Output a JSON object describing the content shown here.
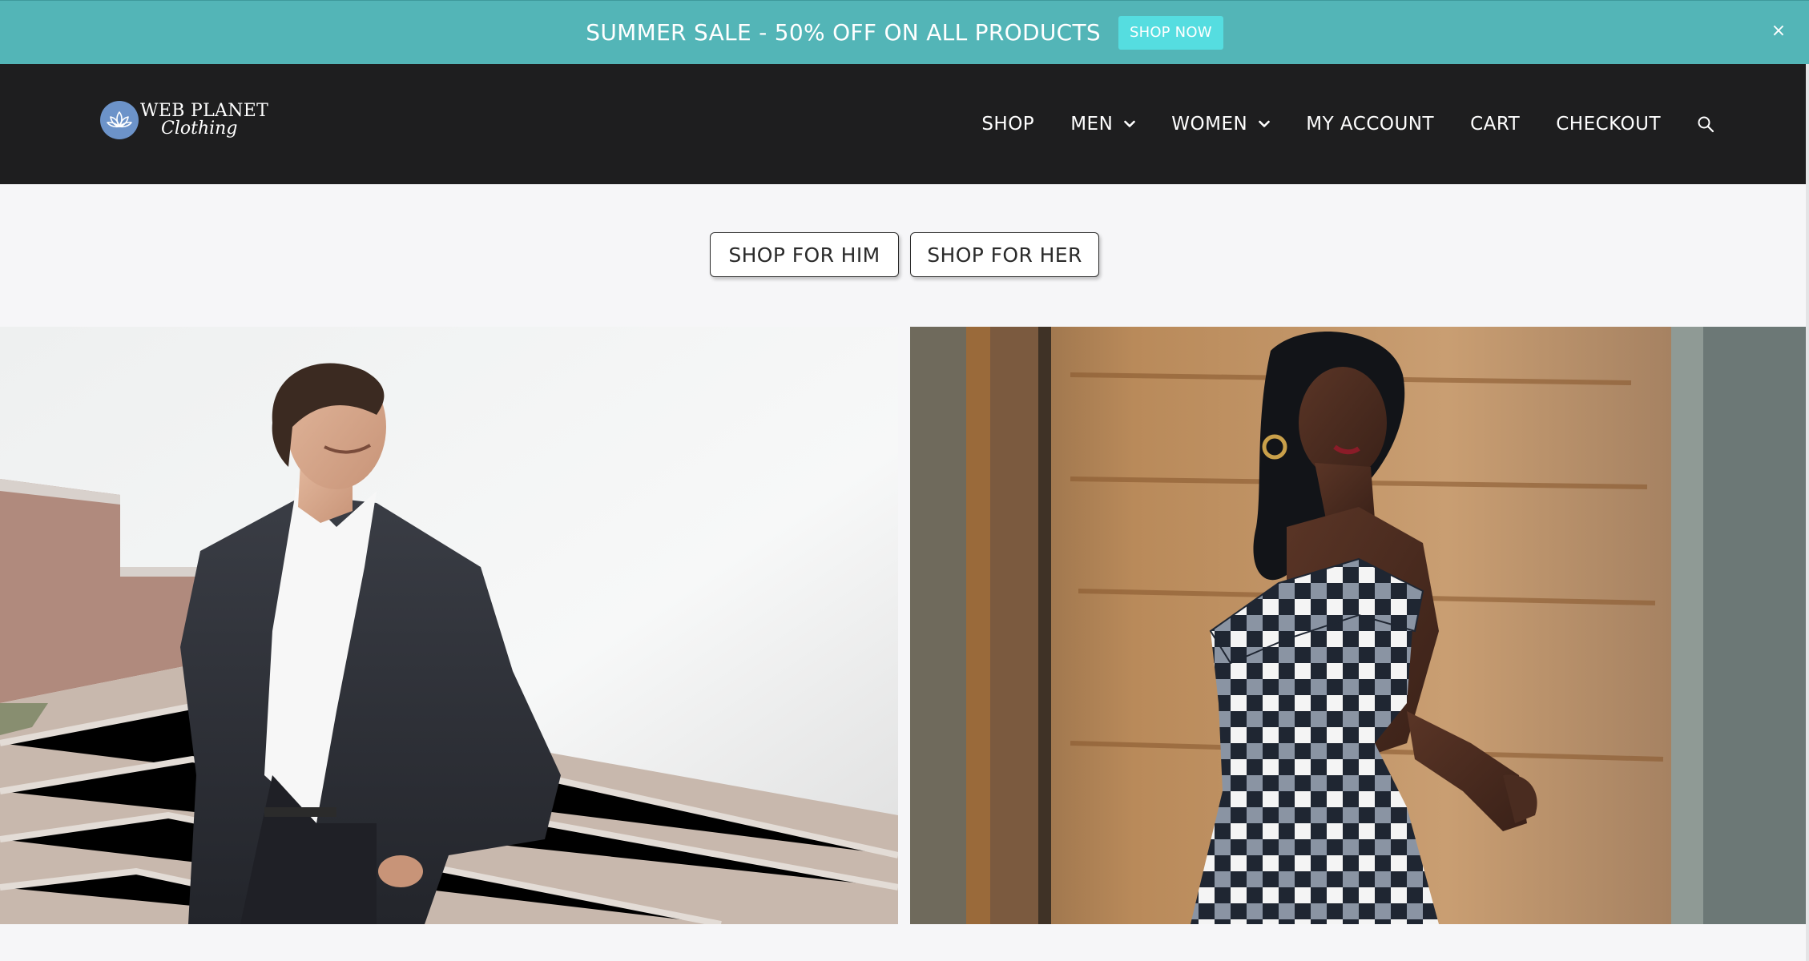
{
  "announcement": {
    "message": "SUMMER SALE - 50% OFF ON ALL PRODUCTS",
    "cta_label": "SHOP NOW",
    "close_label": "×",
    "colors": {
      "bar": "#53b5b7",
      "cta": "#55dde0"
    }
  },
  "header": {
    "logo": {
      "line1": "WEB PLANET",
      "line2": "Clothing",
      "icon": "lotus-icon"
    },
    "nav": [
      {
        "label": "SHOP"
      },
      {
        "label": "MEN",
        "icon": "chevron-down-icon"
      },
      {
        "label": "WOMEN",
        "icon": "chevron-down-icon"
      },
      {
        "label": "MY ACCOUNT"
      },
      {
        "label": "CART"
      },
      {
        "label": "CHECKOUT"
      }
    ],
    "search_icon": "search-icon",
    "colors": {
      "background": "#1e1e1f",
      "text": "#ffffff"
    }
  },
  "shop_buttons": {
    "him": "SHOP FOR HIM",
    "her": "SHOP FOR HER"
  },
  "hero_images": [
    {
      "subject": "men-fashion-photo"
    },
    {
      "subject": "women-fashion-photo"
    }
  ]
}
